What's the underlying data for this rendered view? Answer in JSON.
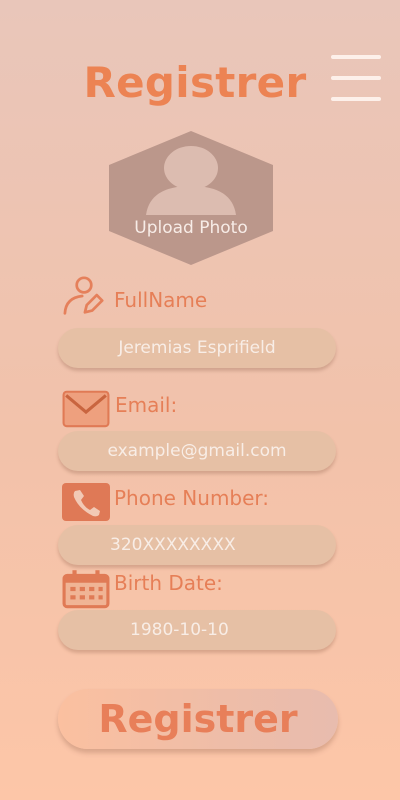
{
  "header": {
    "title": "Registrer",
    "menu_icon": "hamburger-menu-icon"
  },
  "photo": {
    "label": "Upload Photo",
    "icon": "user-silhouette-icon"
  },
  "fields": {
    "fullname": {
      "label": "FullName",
      "value": "Jeremias Esprifield",
      "icon": "user-edit-icon"
    },
    "email": {
      "label": "Email:",
      "placeholder": "example@gmail.com",
      "icon": "envelope-icon"
    },
    "phone": {
      "label": "Phone Number:",
      "value": "320XXXXXXXX",
      "icon": "phone-icon"
    },
    "birth": {
      "label": "Birth Date:",
      "value": "1980-10-10",
      "icon": "calendar-icon"
    }
  },
  "submit": {
    "label": "Registrer"
  },
  "colors": {
    "accent": "#ec8353",
    "field_bg": "#e6c0a5",
    "placeholder": "#f8ede6"
  }
}
